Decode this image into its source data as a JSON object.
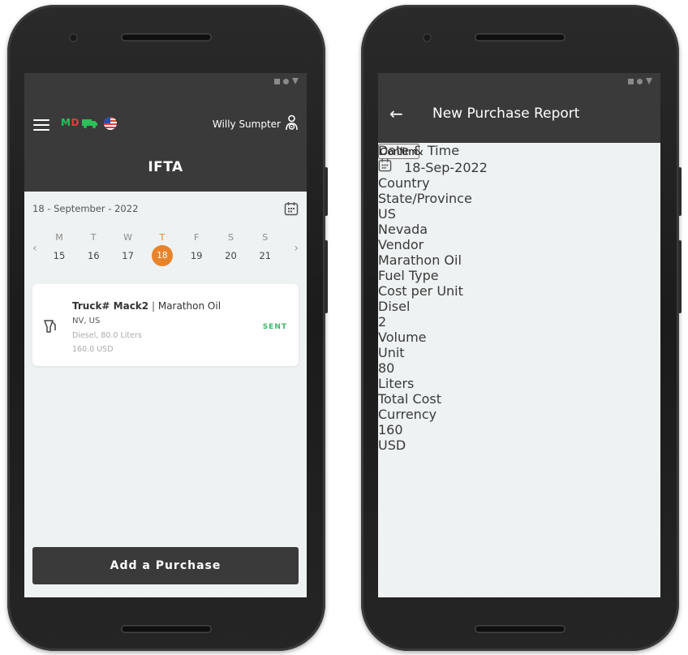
{
  "left": {
    "brand_badge": {
      "m": "M",
      "d": "D"
    },
    "user_name": "Willy Sumpter",
    "title": "IFTA",
    "date_label": "18 - September - 2022",
    "week": [
      {
        "letter": "M",
        "num": "15"
      },
      {
        "letter": "T",
        "num": "16"
      },
      {
        "letter": "W",
        "num": "17"
      },
      {
        "letter": "T",
        "num": "18"
      },
      {
        "letter": "F",
        "num": "19"
      },
      {
        "letter": "S",
        "num": "20"
      },
      {
        "letter": "S",
        "num": "21"
      }
    ],
    "active_day_index": 3,
    "prev_arrow": "‹",
    "next_arrow": "›",
    "card": {
      "truck": "Truck# Mack2",
      "separator": "|",
      "vendor": "Marathon Oil",
      "location": "NV, US",
      "fuel": "Diesel, 80.0 Liters",
      "cost": "160.0 USD",
      "status": "SENT"
    },
    "add_button": "Add a Purchase",
    "colors": {
      "accent": "#e8832a",
      "dark": "#3a3a3a",
      "sent": "#3cba6a"
    },
    "icons": [
      "menu-icon",
      "truck-icon",
      "us-flag-icon",
      "user-icon",
      "calendar-icon",
      "fuel-pump-icon"
    ]
  },
  "right": {
    "back_arrow": "←",
    "title": "New Purchase Report",
    "fields": {
      "date_time": {
        "label": "Date & Time",
        "value": "18-Sep-2022"
      },
      "country": {
        "label": "Country",
        "value": "US"
      },
      "state": {
        "label": "State/Province",
        "value": "Nevada"
      },
      "vendor": {
        "label": "Vendor",
        "value": "Marathon Oil"
      },
      "fuel_type": {
        "label": "Fuel Type",
        "value": "Disel"
      },
      "cost_per_unit": {
        "label": "Cost per Unit",
        "value": "2"
      },
      "volume": {
        "label": "Volume",
        "value": "80"
      },
      "unit": {
        "label": "Unit",
        "value": "Liters"
      },
      "total_cost": {
        "label": "Total Cost",
        "value": "160"
      },
      "currency": {
        "label": "Currency",
        "value": "USD"
      }
    },
    "confirm_button": "Confirm"
  }
}
